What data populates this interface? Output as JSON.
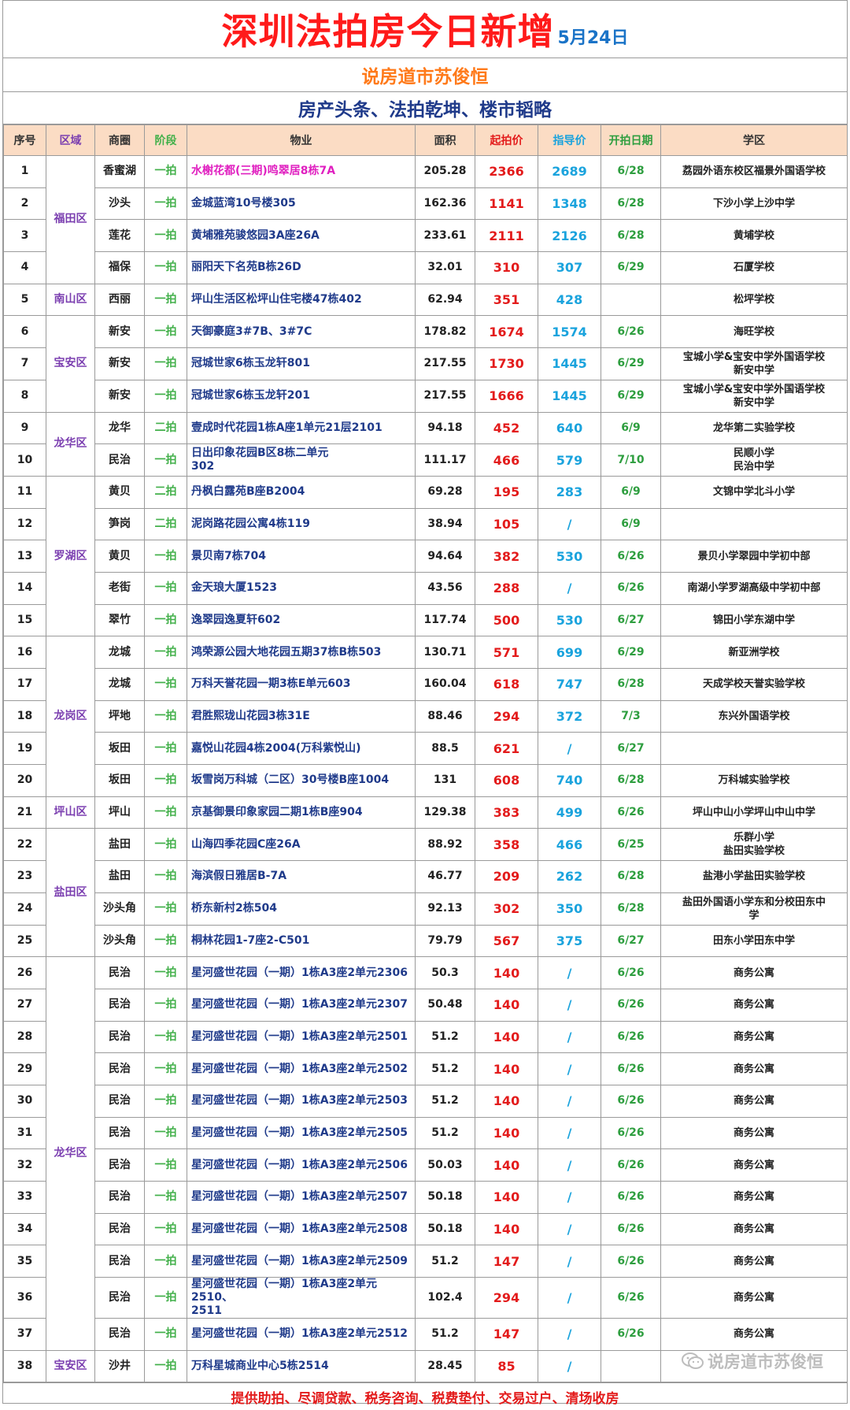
{
  "header": {
    "title": "深圳法拍房今日新增",
    "date": "5月24日"
  },
  "subtitle": "说房道市苏俊恒",
  "tagline": "房产头条、法拍乾坤、楼市韬略",
  "columns": [
    "序号",
    "区域",
    "商圈",
    "阶段",
    "物业",
    "面积",
    "起拍价",
    "指导价",
    "开拍日期",
    "学区"
  ],
  "districts": [
    {
      "name": "福田区"
    },
    {
      "name": "南山区"
    },
    {
      "name": "宝安区"
    },
    {
      "name": "龙华区"
    },
    {
      "name": "罗湖区"
    },
    {
      "name": "龙岗区"
    },
    {
      "name": "坪山区"
    },
    {
      "name": "盐田区"
    },
    {
      "name": "龙华区"
    },
    {
      "name": "宝安区"
    }
  ],
  "rows": [
    {
      "no": "1",
      "area": "香蜜湖",
      "stage": "一拍",
      "property": "水榭花都(三期)鸣翠居8栋7A",
      "size": "205.28",
      "start": "2366",
      "guide": "2689",
      "date": "6/28",
      "school": "荔园外语东校区福景外国语学校",
      "highlight": true
    },
    {
      "no": "2",
      "area": "沙头",
      "stage": "一拍",
      "property": "金城蓝湾10号楼305",
      "size": "162.36",
      "start": "1141",
      "guide": "1348",
      "date": "6/28",
      "school": "下沙小学上沙中学"
    },
    {
      "no": "3",
      "area": "莲花",
      "stage": "一拍",
      "property": "黄埔雅苑骏悠园3A座26A",
      "size": "233.61",
      "start": "2111",
      "guide": "2126",
      "date": "6/28",
      "school": "黄埔学校"
    },
    {
      "no": "4",
      "area": "福保",
      "stage": "一拍",
      "property": "丽阳天下名苑B栋26D",
      "size": "32.01",
      "start": "310",
      "guide": "307",
      "date": "6/29",
      "school": "石厦学校"
    },
    {
      "no": "5",
      "area": "西丽",
      "stage": "一拍",
      "property": "坪山生活区松坪山住宅楼47栋402",
      "size": "62.94",
      "start": "351",
      "guide": "428",
      "date": "",
      "school": "松坪学校"
    },
    {
      "no": "6",
      "area": "新安",
      "stage": "一拍",
      "property": "天御豪庭3#7B、3#7C",
      "size": "178.82",
      "start": "1674",
      "guide": "1574",
      "date": "6/26",
      "school": "海旺学校"
    },
    {
      "no": "7",
      "area": "新安",
      "stage": "一拍",
      "property": "冠城世家6栋玉龙轩801",
      "size": "217.55",
      "start": "1730",
      "guide": "1445",
      "date": "6/29",
      "school": "宝城小学&宝安中学外国语学校\n新安中学"
    },
    {
      "no": "8",
      "area": "新安",
      "stage": "一拍",
      "property": "冠城世家6栋玉龙轩201",
      "size": "217.55",
      "start": "1666",
      "guide": "1445",
      "date": "6/29",
      "school": "宝城小学&宝安中学外国语学校\n新安中学"
    },
    {
      "no": "9",
      "area": "龙华",
      "stage": "二拍",
      "property": "壹成时代花园1栋A座1单元21层2101",
      "size": "94.18",
      "start": "452",
      "guide": "640",
      "date": "6/9",
      "school": "龙华第二实验学校"
    },
    {
      "no": "10",
      "area": "民治",
      "stage": "一拍",
      "property": "日出印象花园B区8栋二单元\n302",
      "size": "111.17",
      "start": "466",
      "guide": "579",
      "date": "7/10",
      "school": "民顺小学\n民治中学"
    },
    {
      "no": "11",
      "area": "黄贝",
      "stage": "二拍",
      "property": "丹枫白露苑B座B2004",
      "size": "69.28",
      "start": "195",
      "guide": "283",
      "date": "6/9",
      "school": "文锦中学北斗小学"
    },
    {
      "no": "12",
      "area": "笋岗",
      "stage": "二拍",
      "property": "泥岗路花园公寓4栋119",
      "size": "38.94",
      "start": "105",
      "guide": "/",
      "date": "6/9",
      "school": ""
    },
    {
      "no": "13",
      "area": "黄贝",
      "stage": "一拍",
      "property": "景贝南7栋704",
      "size": "94.64",
      "start": "382",
      "guide": "530",
      "date": "6/26",
      "school": "景贝小学翠园中学初中部"
    },
    {
      "no": "14",
      "area": "老街",
      "stage": "一拍",
      "property": "金天琅大厦1523",
      "size": "43.56",
      "start": "288",
      "guide": "/",
      "date": "6/26",
      "school": "南湖小学罗湖高级中学初中部"
    },
    {
      "no": "15",
      "area": "翠竹",
      "stage": "一拍",
      "property": "逸翠园逸夏轩602",
      "size": "117.74",
      "start": "500",
      "guide": "530",
      "date": "6/27",
      "school": "锦田小学东湖中学"
    },
    {
      "no": "16",
      "area": "龙城",
      "stage": "一拍",
      "property": "鸿荣源公园大地花园五期37栋B栋503",
      "size": "130.71",
      "start": "571",
      "guide": "699",
      "date": "6/29",
      "school": "新亚洲学校"
    },
    {
      "no": "17",
      "area": "龙城",
      "stage": "一拍",
      "property": "万科天誉花园一期3栋E单元603",
      "size": "160.04",
      "start": "618",
      "guide": "747",
      "date": "6/28",
      "school": "天成学校天誉实验学校"
    },
    {
      "no": "18",
      "area": "坪地",
      "stage": "一拍",
      "property": "君胜熙珑山花园3栋31E",
      "size": "88.46",
      "start": "294",
      "guide": "372",
      "date": "7/3",
      "school": "东兴外国语学校"
    },
    {
      "no": "19",
      "area": "坂田",
      "stage": "一拍",
      "property": "嘉悦山花园4栋2004(万科紫悦山)",
      "size": "88.5",
      "start": "621",
      "guide": "/",
      "date": "6/27",
      "school": ""
    },
    {
      "no": "20",
      "area": "坂田",
      "stage": "一拍",
      "property": "坂雪岗万科城（二区）30号楼B座1004",
      "size": "131",
      "start": "608",
      "guide": "740",
      "date": "6/28",
      "school": "万科城实验学校"
    },
    {
      "no": "21",
      "area": "坪山",
      "stage": "一拍",
      "property": "京基御景印象家园二期1栋B座904",
      "size": "129.38",
      "start": "383",
      "guide": "499",
      "date": "6/26",
      "school": "坪山中山小学坪山中山中学"
    },
    {
      "no": "22",
      "area": "盐田",
      "stage": "一拍",
      "property": "山海四季花园C座26A",
      "size": "88.92",
      "start": "358",
      "guide": "466",
      "date": "6/25",
      "school": "乐群小学\n盐田实验学校"
    },
    {
      "no": "23",
      "area": "盐田",
      "stage": "一拍",
      "property": "海滨假日雅居B-7A",
      "size": "46.77",
      "start": "209",
      "guide": "262",
      "date": "6/28",
      "school": "盐港小学盐田实验学校"
    },
    {
      "no": "24",
      "area": "沙头角",
      "stage": "一拍",
      "property": "桥东新村2栋504",
      "size": "92.13",
      "start": "302",
      "guide": "350",
      "date": "6/28",
      "school": "盐田外国语小学东和分校田东中\n学"
    },
    {
      "no": "25",
      "area": "沙头角",
      "stage": "一拍",
      "property": "桐林花园1-7座2-C501",
      "size": "79.79",
      "start": "567",
      "guide": "375",
      "date": "6/27",
      "school": "田东小学田东中学"
    },
    {
      "no": "26",
      "area": "民治",
      "stage": "一拍",
      "property": "星河盛世花园（一期）1栋A3座2单元2306",
      "size": "50.3",
      "start": "140",
      "guide": "/",
      "date": "6/26",
      "school": "商务公寓"
    },
    {
      "no": "27",
      "area": "民治",
      "stage": "一拍",
      "property": "星河盛世花园（一期）1栋A3座2单元2307",
      "size": "50.48",
      "start": "140",
      "guide": "/",
      "date": "6/26",
      "school": "商务公寓"
    },
    {
      "no": "28",
      "area": "民治",
      "stage": "一拍",
      "property": "星河盛世花园（一期）1栋A3座2单元2501",
      "size": "51.2",
      "start": "140",
      "guide": "/",
      "date": "6/26",
      "school": "商务公寓"
    },
    {
      "no": "29",
      "area": "民治",
      "stage": "一拍",
      "property": "星河盛世花园（一期）1栋A3座2单元2502",
      "size": "51.2",
      "start": "140",
      "guide": "/",
      "date": "6/26",
      "school": "商务公寓"
    },
    {
      "no": "30",
      "area": "民治",
      "stage": "一拍",
      "property": "星河盛世花园（一期）1栋A3座2单元2503",
      "size": "51.2",
      "start": "140",
      "guide": "/",
      "date": "6/26",
      "school": "商务公寓"
    },
    {
      "no": "31",
      "area": "民治",
      "stage": "一拍",
      "property": "星河盛世花园（一期）1栋A3座2单元2505",
      "size": "51.2",
      "start": "140",
      "guide": "/",
      "date": "6/26",
      "school": "商务公寓"
    },
    {
      "no": "32",
      "area": "民治",
      "stage": "一拍",
      "property": "星河盛世花园（一期）1栋A3座2单元2506",
      "size": "50.03",
      "start": "140",
      "guide": "/",
      "date": "6/26",
      "school": "商务公寓"
    },
    {
      "no": "33",
      "area": "民治",
      "stage": "一拍",
      "property": "星河盛世花园（一期）1栋A3座2单元2507",
      "size": "50.18",
      "start": "140",
      "guide": "/",
      "date": "6/26",
      "school": "商务公寓"
    },
    {
      "no": "34",
      "area": "民治",
      "stage": "一拍",
      "property": "星河盛世花园（一期）1栋A3座2单元2508",
      "size": "50.18",
      "start": "140",
      "guide": "/",
      "date": "6/26",
      "school": "商务公寓"
    },
    {
      "no": "35",
      "area": "民治",
      "stage": "一拍",
      "property": "星河盛世花园（一期）1栋A3座2单元2509",
      "size": "51.2",
      "start": "147",
      "guide": "/",
      "date": "6/26",
      "school": "商务公寓"
    },
    {
      "no": "36",
      "area": "民治",
      "stage": "一拍",
      "property": "星河盛世花园（一期）1栋A3座2单元2510、\n2511",
      "size": "102.4",
      "start": "294",
      "guide": "/",
      "date": "6/26",
      "school": "商务公寓"
    },
    {
      "no": "37",
      "area": "民治",
      "stage": "一拍",
      "property": "星河盛世花园（一期）1栋A3座2单元2512",
      "size": "51.2",
      "start": "147",
      "guide": "/",
      "date": "6/26",
      "school": "商务公寓"
    },
    {
      "no": "38",
      "area": "沙井",
      "stage": "一拍",
      "property": "万科星城商业中心5栋2514",
      "size": "28.45",
      "start": "85",
      "guide": "/",
      "date": "",
      "school": ""
    }
  ],
  "footer": "提供助拍、尽调贷款、税务咨询、税费垫付、交易过户、清场收房",
  "watermark": "说房道市苏俊恒",
  "colors": {
    "title": "#ff1a1a",
    "date": "#1a73c7",
    "subtitle": "#ff7a1a",
    "tagline": "#1f3a8a",
    "header_bg": "#fbdcc4",
    "start_price": "#e31b1b",
    "guide_price": "#1aa3dd",
    "stage": "#42b04a",
    "district": "#7b3fb0",
    "highlight_property": "#e020c0"
  },
  "icons": {
    "watermark_icon": "wechat-icon"
  }
}
